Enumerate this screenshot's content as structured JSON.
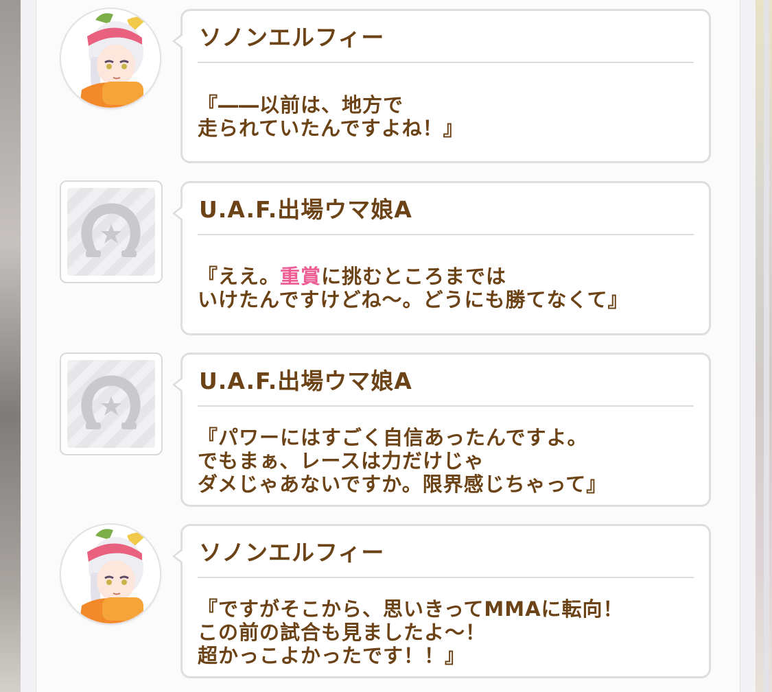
{
  "entries": [
    {
      "speaker": "ソノンエルフィー",
      "avatar": "character-portrait",
      "lines": [
        "『――以前は、地方で",
        "走られていたんですよね！』"
      ]
    },
    {
      "speaker": "U.A.F.出場ウマ娘A",
      "avatar": "horseshoe-placeholder-icon",
      "line1_pre": "『ええ。",
      "line1_highlight": "重賞",
      "line1_post": "に挑むところまでは",
      "line2": "いけたんですけどね～。どうにも勝てなくて』"
    },
    {
      "speaker": "U.A.F.出場ウマ娘A",
      "avatar": "horseshoe-placeholder-icon",
      "lines": [
        "『パワーにはすごく自信あったんですよ。",
        "でもまぁ、レースは力だけじゃ",
        "ダメじゃあないですか。限界感じちゃって』"
      ]
    },
    {
      "speaker": "ソノンエルフィー",
      "avatar": "character-portrait",
      "lines": [
        "『ですがそこから、思いきってMMAに転向！",
        "この前の試合も見ましたよ～！",
        "超かっこよかったです！！』"
      ]
    }
  ],
  "colors": {
    "text": "#6b4316",
    "highlight": "#ef5d95",
    "bubble_border": "#dedde2"
  }
}
